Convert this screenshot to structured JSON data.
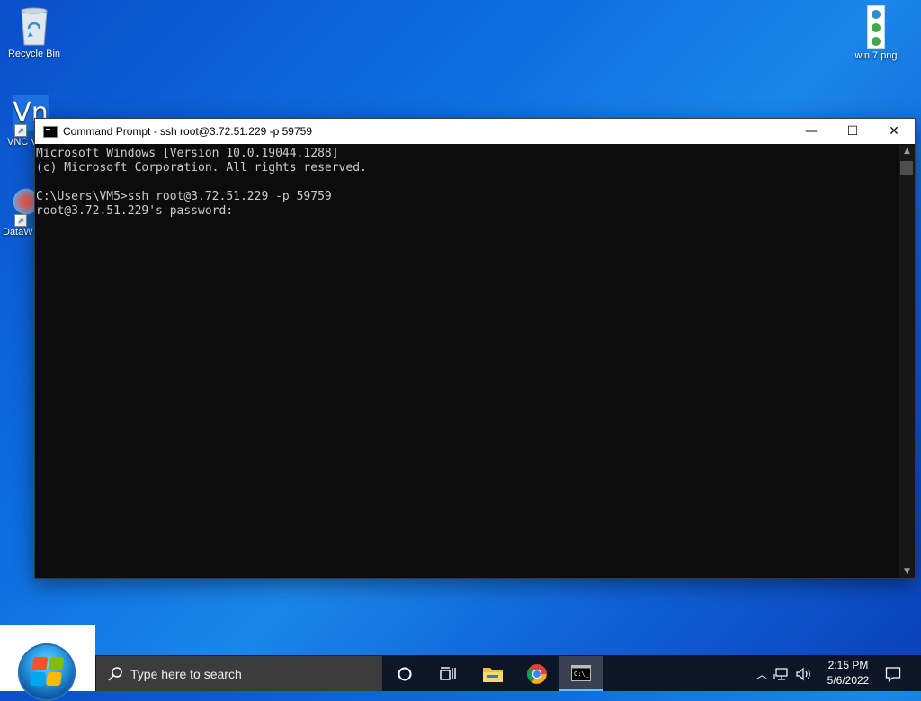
{
  "desktop": {
    "icons": [
      {
        "label": "Recycle Bin"
      },
      {
        "label": "VNC V"
      },
      {
        "label": "DataW"
      },
      {
        "label": "win 7.png"
      }
    ]
  },
  "window": {
    "title": "Command Prompt - ssh  root@3.72.51.229 -p 59759",
    "console_lines": [
      "Microsoft Windows [Version 10.0.19044.1288]",
      "(c) Microsoft Corporation. All rights reserved.",
      "",
      "C:\\Users\\VM5>ssh root@3.72.51.229 -p 59759",
      "root@3.72.51.229's password:"
    ],
    "buttons": {
      "minimize": "—",
      "maximize": "☐",
      "close": "✕"
    }
  },
  "taskbar": {
    "search_placeholder": "Type here to search",
    "clock": {
      "time": "2:15 PM",
      "date": "5/6/2022"
    },
    "apps": [
      "cortana-icon",
      "task-view-icon",
      "file-explorer-icon",
      "chrome-icon",
      "command-prompt-icon"
    ]
  }
}
